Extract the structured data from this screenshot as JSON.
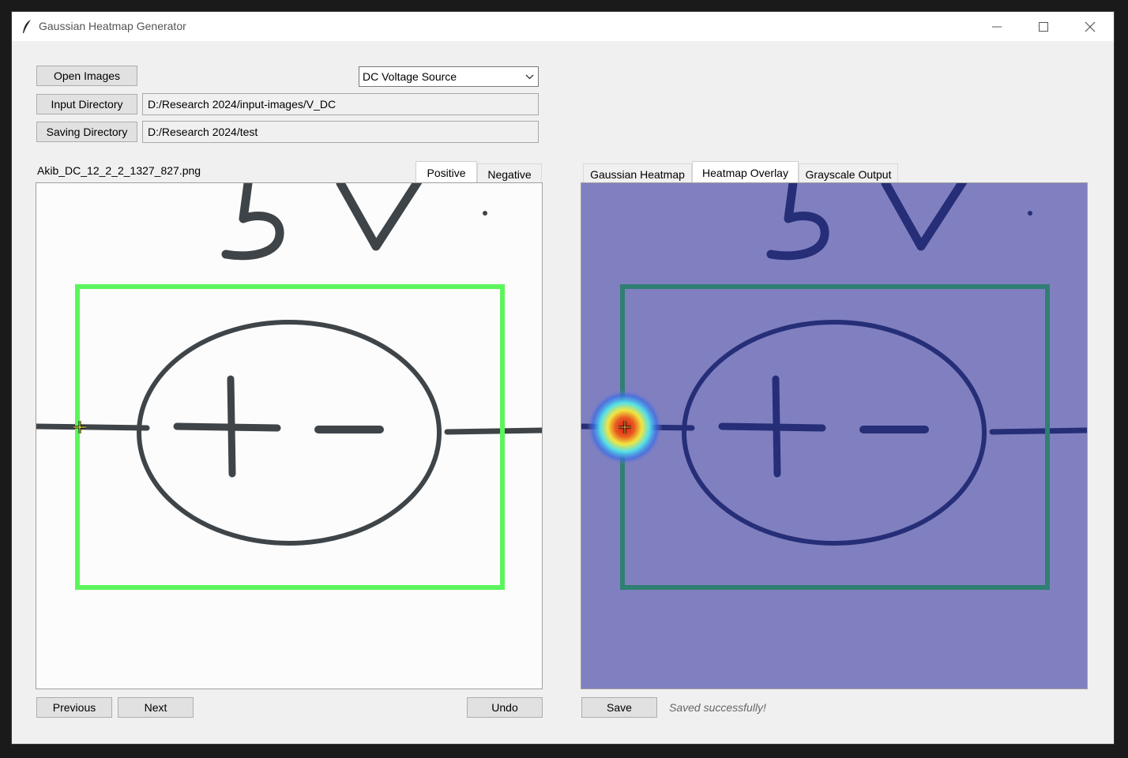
{
  "window": {
    "title": "Gaussian Heatmap Generator",
    "controls": [
      "minimize-icon",
      "maximize-icon",
      "close-icon"
    ]
  },
  "toolbar": {
    "open_images_label": "Open Images",
    "input_directory_label": "Input Directory",
    "saving_directory_label": "Saving Directory",
    "input_directory_value": "D:/Research 2024/input-images/V_DC",
    "saving_directory_value": "D:/Research 2024/test",
    "class_select": {
      "value": "DC Voltage Source"
    }
  },
  "left_panel": {
    "filename": "Akib_DC_12_2_2_1327_827.png",
    "tabs": [
      {
        "label": "Positive",
        "active": true
      },
      {
        "label": "Negative",
        "active": false
      }
    ],
    "previous_label": "Previous",
    "next_label": "Next",
    "undo_label": "Undo"
  },
  "right_panel": {
    "tabs": [
      {
        "label": "Gaussian Heatmap",
        "active": false
      },
      {
        "label": "Heatmap Overlay",
        "active": true
      },
      {
        "label": "Grayscale Output",
        "active": false
      }
    ],
    "save_label": "Save",
    "status": "Saved successfully!"
  },
  "colors": {
    "bbox_green": "#5cf55c",
    "overlay_bbox": "#2f7f72",
    "overlay_background": "#8080c0",
    "heat_center": "#d02020"
  }
}
